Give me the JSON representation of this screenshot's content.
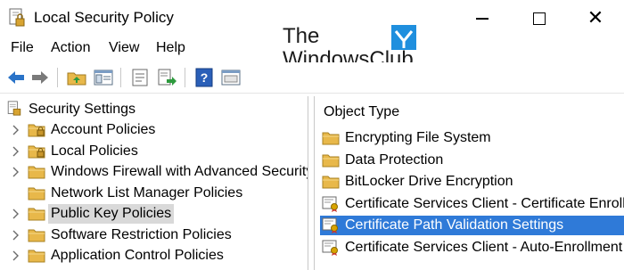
{
  "window": {
    "title": "Local Security Policy",
    "controls": {
      "minimize": "—",
      "maximize": "□",
      "close": "✕"
    }
  },
  "watermark": {
    "line1": "The",
    "line2": "WindowsClub",
    "logo_color": "#1f8fde"
  },
  "menu": {
    "file": "File",
    "action": "Action",
    "view": "View",
    "help": "Help"
  },
  "toolbar": {
    "buttons": [
      "back-arrow-icon",
      "forward-arrow-icon",
      "up-folder-icon",
      "show-hide-tree-icon",
      "properties-icon",
      "export-list-icon",
      "help-icon",
      "console-icon"
    ]
  },
  "tree": {
    "root": "Security Settings",
    "items": [
      {
        "label": "Account Policies",
        "expandable": true,
        "selected": false
      },
      {
        "label": "Local Policies",
        "expandable": true,
        "selected": false
      },
      {
        "label": "Windows Firewall with Advanced Security",
        "expandable": true,
        "selected": false
      },
      {
        "label": "Network List Manager Policies",
        "expandable": false,
        "selected": false
      },
      {
        "label": "Public Key Policies",
        "expandable": true,
        "selected": true
      },
      {
        "label": "Software Restriction Policies",
        "expandable": true,
        "selected": false
      },
      {
        "label": "Application Control Policies",
        "expandable": true,
        "selected": false
      }
    ]
  },
  "list": {
    "column_header": "Object Type",
    "items": [
      {
        "label": "Encrypting File System",
        "icon": "folder-icon",
        "selected": false
      },
      {
        "label": "Data Protection",
        "icon": "folder-icon",
        "selected": false
      },
      {
        "label": "BitLocker Drive Encryption",
        "icon": "folder-icon",
        "selected": false
      },
      {
        "label": "Certificate Services Client - Certificate Enrollm",
        "icon": "certificate-icon",
        "selected": false
      },
      {
        "label": "Certificate Path Validation Settings",
        "icon": "certificate-icon",
        "selected": true
      },
      {
        "label": "Certificate Services Client - Auto-Enrollment",
        "icon": "certificate-icon",
        "selected": false
      }
    ]
  },
  "colors": {
    "selection": "#2f7ad8",
    "tree_selection": "#d9d9d9",
    "folder": "#e8b84a"
  }
}
